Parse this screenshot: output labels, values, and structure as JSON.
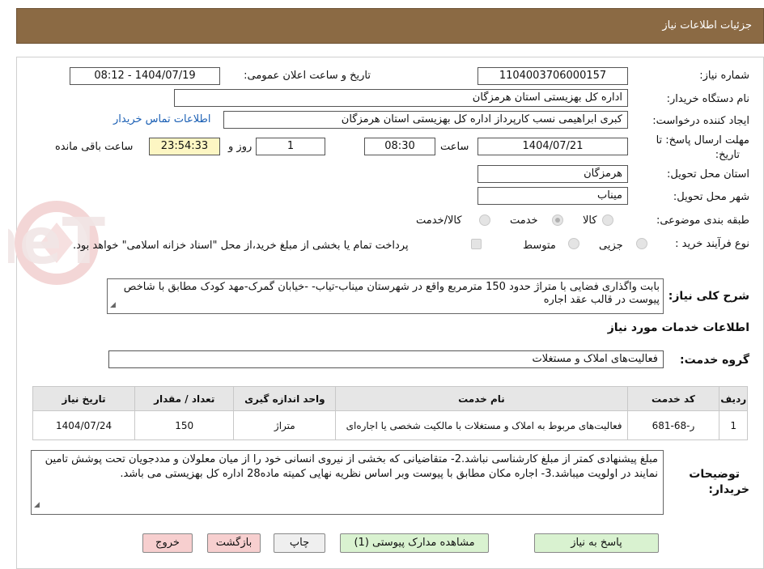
{
  "header": {
    "title": "جزئیات اطلاعات نیاز"
  },
  "form": {
    "need_number_label": "شماره نیاز:",
    "need_number": "1104003706000157",
    "announce_label": "تاریخ و ساعت اعلان عمومی:",
    "announce_value": "1404/07/19 - 08:12",
    "buyer_org_label": "نام دستگاه خریدار:",
    "buyer_org": "اداره کل بهزیستی استان هرمزگان",
    "creator_label": "ایجاد کننده درخواست:",
    "creator": "کبری  ابراهیمی نسب کارپرداز اداره کل بهزیستی استان هرمزگان",
    "contact_link": "اطلاعات تماس خریدار",
    "deadline_label_1": "مهلت ارسال پاسخ: تا",
    "deadline_label_2": "تاریخ:",
    "deadline_date": "1404/07/21",
    "time_label": "ساعت",
    "deadline_time": "08:30",
    "days_value": "1",
    "days_label": "روز و",
    "remaining_time": "23:54:33",
    "remaining_label": "ساعت باقی مانده",
    "province_label": "استان محل تحویل:",
    "province": "هرمزگان",
    "city_label": "شهر محل تحویل:",
    "city": "میناب",
    "category_label": "طبقه بندی موضوعی:",
    "category_options": [
      "کالا",
      "خدمت",
      "کالا/خدمت"
    ],
    "category_selected": "خدمت",
    "process_label": "نوع فرآیند خرید :",
    "process_options": [
      "جزیی",
      "متوسط"
    ],
    "payment_note": "پرداخت تمام یا بخشی از مبلغ خرید،از محل \"اسناد خزانه اسلامی\" خواهد بود.",
    "general_desc_label": "شرح کلی نیاز:",
    "general_desc": "بابت واگذاری فضایی با متراژ حدود  150 مترمربع واقع در شهرستان میناب-تیاب- -خیابان گمرک-مهد کودک مطابق با شاخص پیوست در قالب عقد اجاره",
    "services_section": "اطلاعات خدمات مورد نیاز",
    "service_group_label": "گروه خدمت:",
    "service_group": "فعالیت‌های  املاک و مستغلات"
  },
  "table": {
    "headers": [
      "ردیف",
      "کد خدمت",
      "نام خدمت",
      "واحد اندازه گیری",
      "تعداد / مقدار",
      "تاریخ نیاز"
    ],
    "rows": [
      [
        "1",
        "ر-68-681",
        "فعالیت‌های مربوط به املاک و مستغلات با مالکیت شخصی یا اجاره‌ای",
        "متراژ",
        "150",
        "1404/07/24"
      ]
    ]
  },
  "buyer_notes": {
    "label_1": "توضیحات",
    "label_2": "خریدار:",
    "text": "مبلغ پیشنهادی کمتر از مبلغ کارشناسی نباشد.2- متقاضیانی که بخشی از نیروی انسانی خود را از میان معلولان و مددجویان تحت پوشش تامین نمایند در اولویت میباشد.3-  اجاره مکان  مطابق با پیوست وبر اساس نظریه نهایی کمیته ماده28 اداره کل بهزیستی می باشد."
  },
  "buttons": {
    "reply": "پاسخ به نیاز",
    "attachments": "مشاهده مدارک پیوستی (1)",
    "print": "چاپ",
    "back": "بازگشت",
    "exit": "خروج"
  },
  "colors": {
    "header": "#8b6a44",
    "yellow": "#fdf6c3",
    "link": "#1a5fb4"
  }
}
